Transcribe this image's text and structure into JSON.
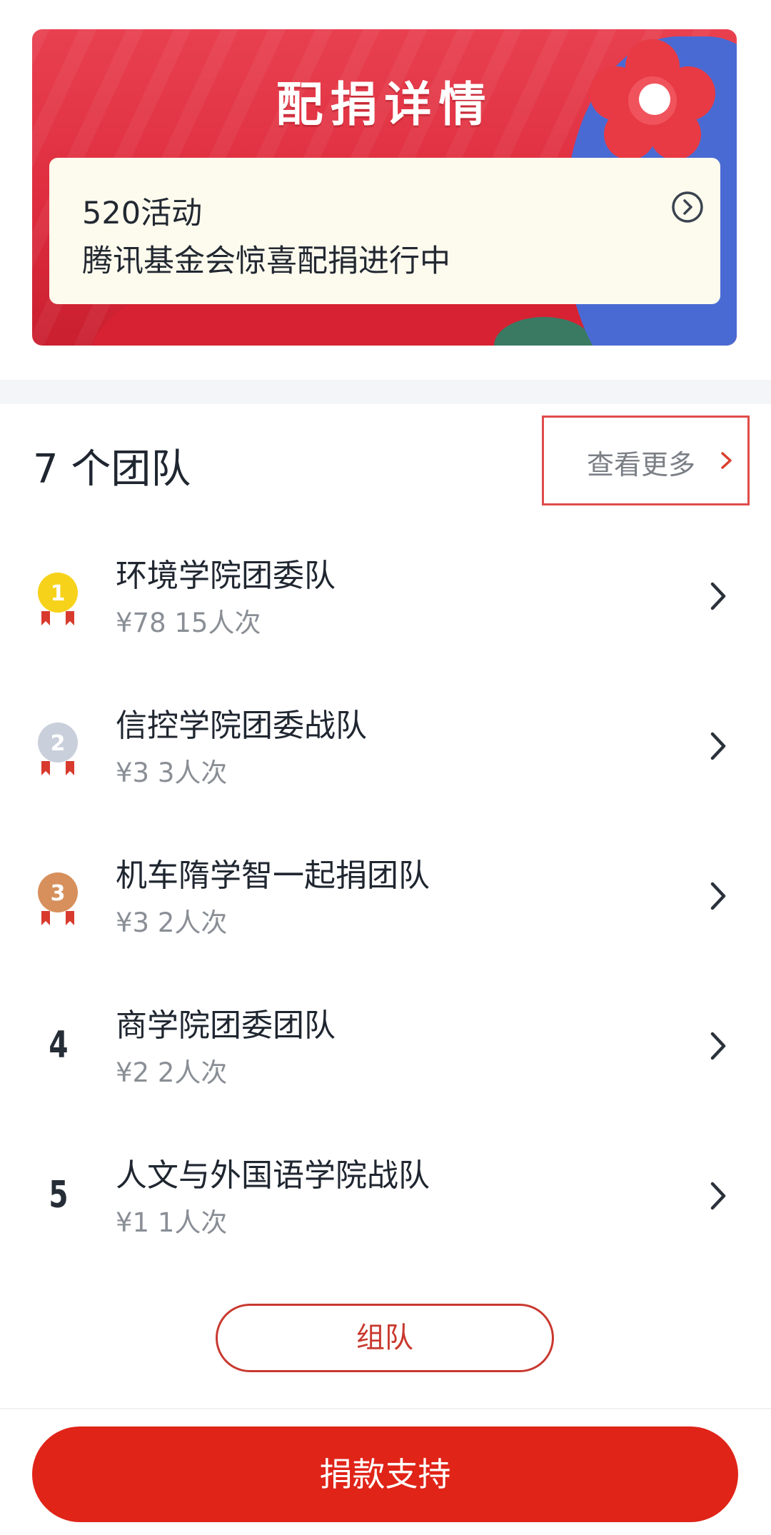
{
  "banner": {
    "title": "配捐详情",
    "event_name": "520活动",
    "event_desc": "腾讯基金会惊喜配捐进行中",
    "card_arrow_icon": "circle-chevron-right-icon",
    "colors": {
      "background": "#de2d3e",
      "card": "#fdfbee",
      "accent_blue": "#4a6ad3"
    }
  },
  "teams": {
    "title": "7 个团队",
    "see_more_label": "查看更多",
    "see_more_icon": "chevron-right-icon",
    "items": [
      {
        "rank": "1",
        "name": "环境学院团委队",
        "stats": "¥78 15人次",
        "badge": "gold-medal-icon"
      },
      {
        "rank": "2",
        "name": "信控学院团委战队",
        "stats": "¥3 3人次",
        "badge": "silver-medal-icon"
      },
      {
        "rank": "3",
        "name": "机车隋学智一起捐团队",
        "stats": "¥3 2人次",
        "badge": "bronze-medal-icon"
      },
      {
        "rank": "4",
        "name": "商学院团委团队",
        "stats": "¥2 2人次"
      },
      {
        "rank": "5",
        "name": "人文与外国语学院战队",
        "stats": "¥1 1人次"
      }
    ]
  },
  "actions": {
    "team_up_label": "组队",
    "donate_label": "捐款支持"
  },
  "colors": {
    "primary_red": "#e02418",
    "outline_red": "#c8392f",
    "highlight_border": "#e04b4b",
    "gold": "#f7d21a",
    "silver": "#c9cfdb",
    "bronze": "#d7905c"
  }
}
